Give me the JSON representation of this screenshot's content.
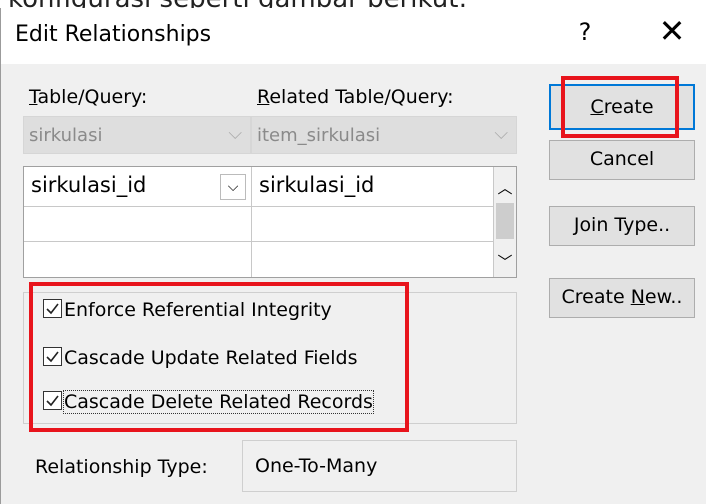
{
  "cutoff_text": "konfigurasi seperti gambar berikut:",
  "dialog": {
    "title": "Edit Relationships",
    "help": "?",
    "close": "✕"
  },
  "labels": {
    "table_query": "Table/Query:",
    "related_table_query": "Related Table/Query:"
  },
  "combos": {
    "table": "sirkulasi",
    "related": "item_sirkulasi"
  },
  "grid": {
    "rows": [
      {
        "left": "sirkulasi_id",
        "right": "sirkulasi_id"
      },
      {
        "left": "",
        "right": ""
      },
      {
        "left": "",
        "right": ""
      }
    ]
  },
  "options": {
    "enforce": {
      "label": "Enforce Referential Integrity",
      "checked": true
    },
    "cascade_update": {
      "label": "Cascade Update Related Fields",
      "checked": true
    },
    "cascade_delete": {
      "label": "Cascade Delete Related Records",
      "checked": true
    }
  },
  "relationship": {
    "label": "Relationship Type:",
    "value": "One-To-Many"
  },
  "buttons": {
    "create": "Create",
    "cancel": "Cancel",
    "join_type": "Join Type..",
    "create_new": "Create New.."
  },
  "colors": {
    "highlight": "#e8141c",
    "default_button_border": "#0078d7"
  }
}
